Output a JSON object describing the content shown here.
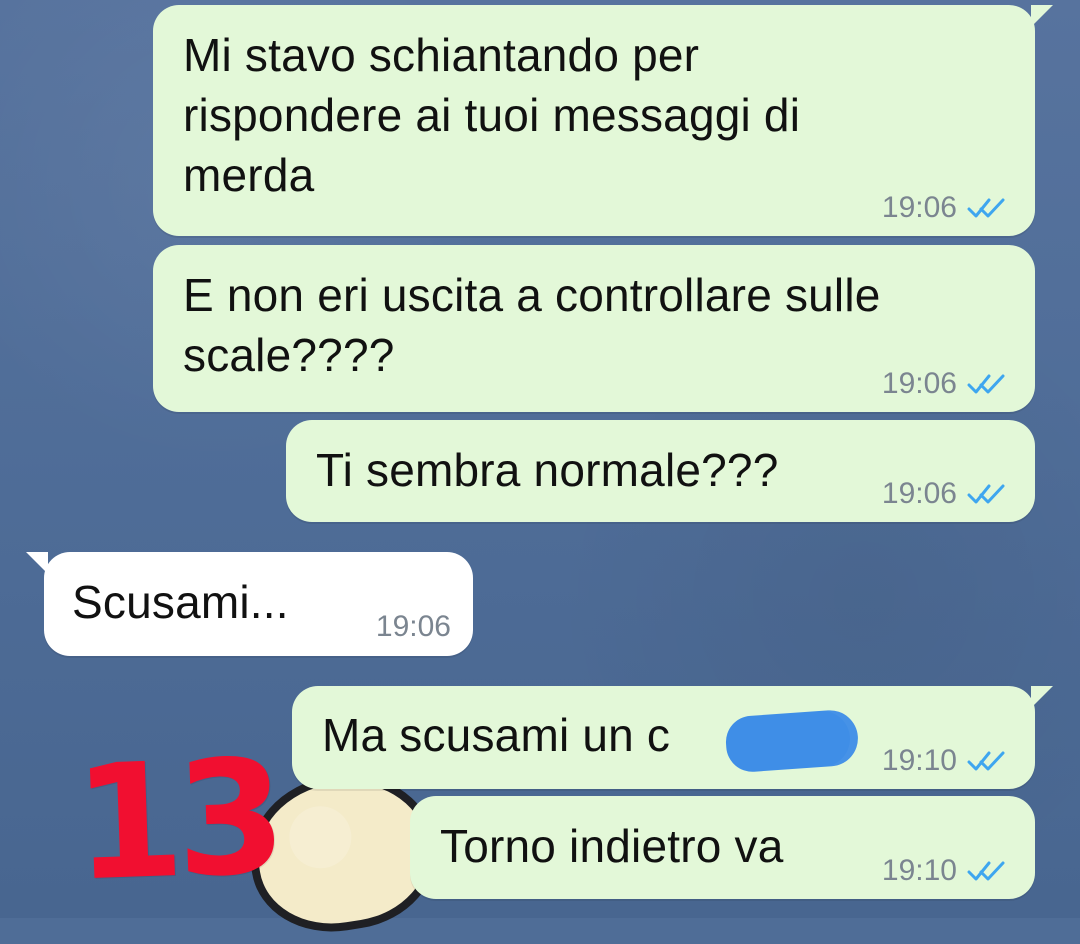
{
  "messages": [
    {
      "text": "Mi stavo schiantando per\nrispondere ai tuoi messaggi di\nmerda",
      "time": "19:06"
    },
    {
      "text": "E non eri uscita a controllare sulle\nscale????",
      "time": "19:06"
    },
    {
      "text": "Ti sembra normale???",
      "time": "19:06"
    },
    {
      "text": "Scusami...",
      "time": "19:06"
    },
    {
      "text": "Ma scusami un c",
      "time": "19:10"
    },
    {
      "text": "Torno indietro va",
      "time": "19:10"
    }
  ],
  "annotation": {
    "text": "13",
    "color": "#f10f30"
  },
  "colors": {
    "outgoing_bubble": "#e3f8d8",
    "incoming_bubble": "#ffffff",
    "read_receipt": "#3ea6ef",
    "censor_blob": "#3f8ee7"
  },
  "icons": {
    "read_receipt": "double-check-icon"
  }
}
